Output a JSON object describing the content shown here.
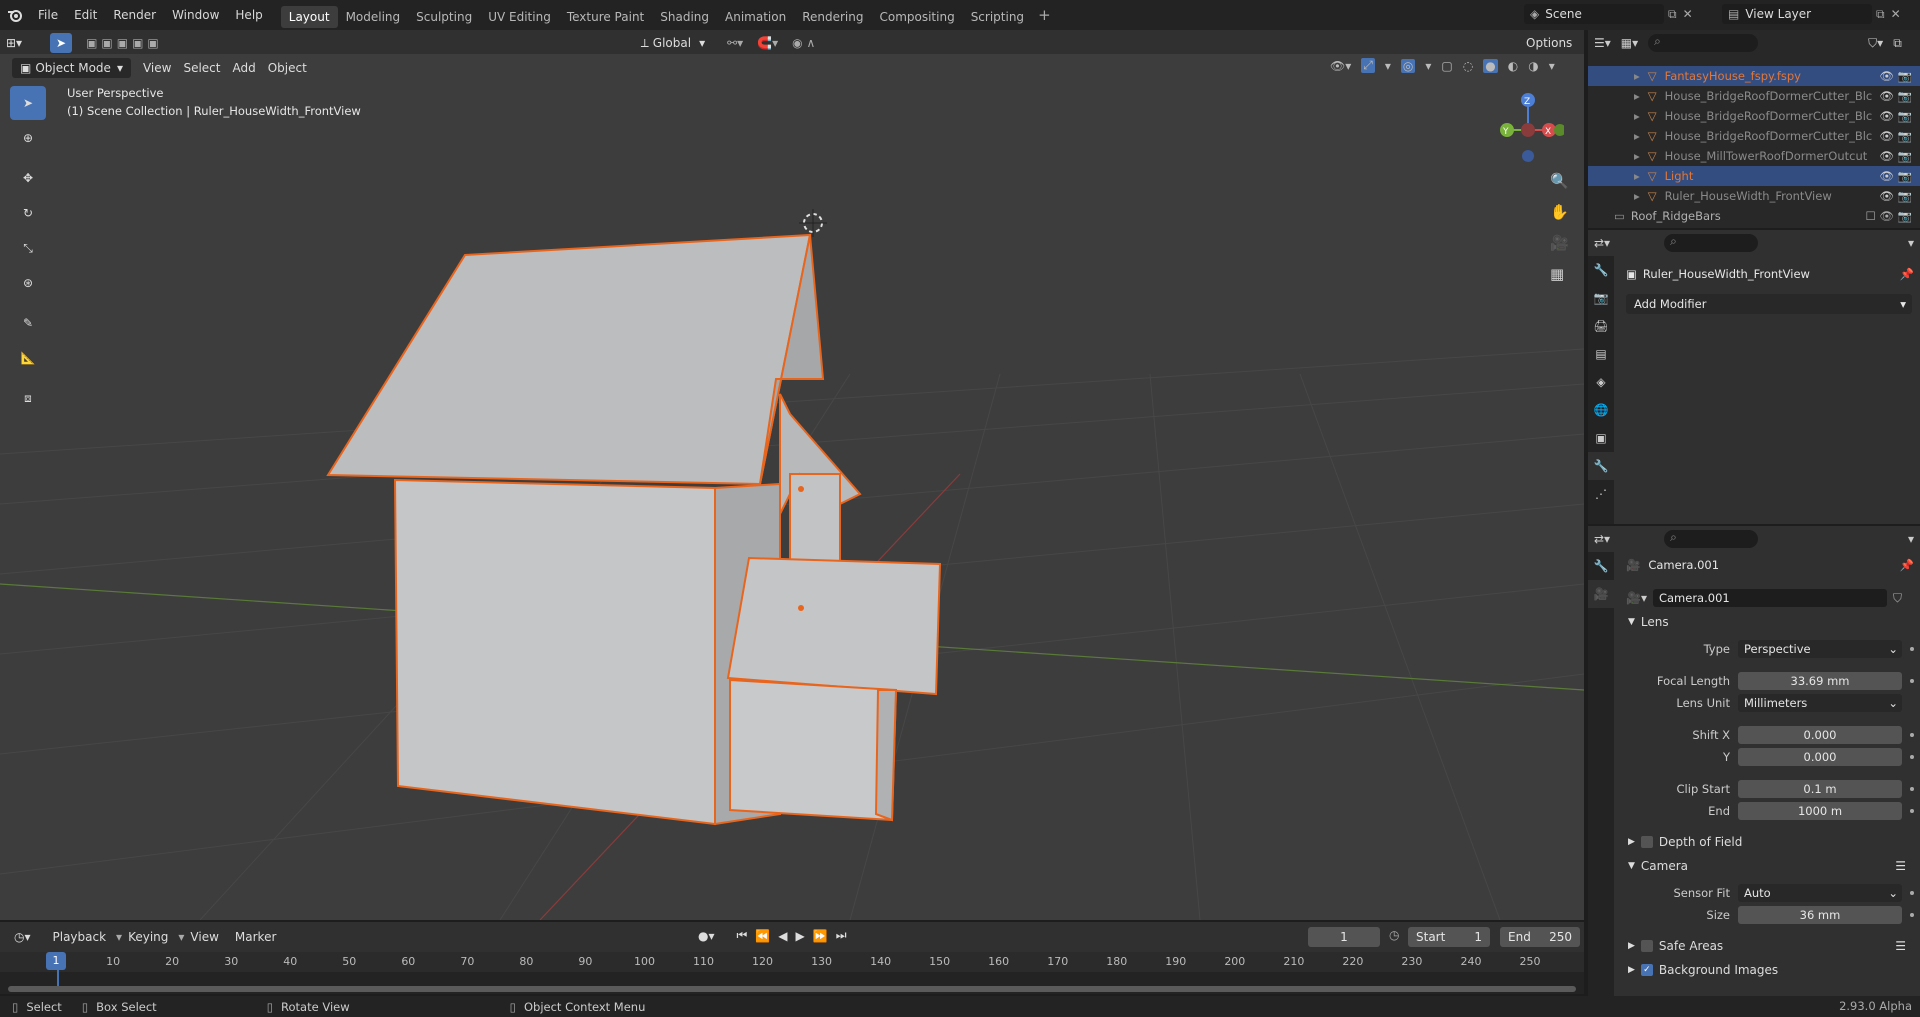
{
  "topbar": {
    "menus": [
      "File",
      "Edit",
      "Render",
      "Window",
      "Help"
    ],
    "workspaces": [
      "Layout",
      "Modeling",
      "Sculpting",
      "UV Editing",
      "Texture Paint",
      "Shading",
      "Animation",
      "Rendering",
      "Compositing",
      "Scripting"
    ],
    "active_workspace": "Layout",
    "scene": "Scene",
    "view_layer": "View Layer"
  },
  "viewport_header": {
    "mode": "Object Mode",
    "menus": [
      "View",
      "Select",
      "Add",
      "Object"
    ],
    "transform_orientation": "Global",
    "options_label": "Options"
  },
  "viewport": {
    "perspective_label": "User Perspective",
    "collection_label": "(1) Scene Collection | Ruler_HouseWidth_FrontView",
    "gizmo": {
      "x": "X",
      "y": "Y",
      "z": "Z"
    }
  },
  "outliner": {
    "items": [
      {
        "label": "FantasyHouse_fspy.fspy",
        "selected": true,
        "color": "#e0773a"
      },
      {
        "label": "House_BridgeRoofDormerCutter_Blc",
        "selected": false,
        "color": "#8a8a8a"
      },
      {
        "label": "House_BridgeRoofDormerCutter_Blc",
        "selected": false,
        "color": "#8a8a8a"
      },
      {
        "label": "House_BridgeRoofDormerCutter_Blc",
        "selected": false,
        "color": "#8a8a8a"
      },
      {
        "label": "House_MillTowerRoofDormerOutcut",
        "selected": false,
        "color": "#8a8a8a"
      },
      {
        "label": "Light",
        "selected": true,
        "color": "#e0773a"
      },
      {
        "label": "Ruler_HouseWidth_FrontView",
        "selected": false,
        "color": "#8a8a8a"
      }
    ],
    "collection": "Roof_RidgeBars"
  },
  "modifier_panel": {
    "object_name": "Ruler_HouseWidth_FrontView",
    "add_modifier": "Add Modifier"
  },
  "camera_panel": {
    "object_name": "Camera.001",
    "data_name": "Camera.001",
    "lens_section": "Lens",
    "type_label": "Type",
    "type_value": "Perspective",
    "focal_label": "Focal Length",
    "focal_value": "33.69 mm",
    "lens_unit_label": "Lens Unit",
    "lens_unit_value": "Millimeters",
    "shift_x_label": "Shift X",
    "shift_x_value": "0.000",
    "shift_y_label": "Y",
    "shift_y_value": "0.000",
    "clip_start_label": "Clip Start",
    "clip_start_value": "0.1 m",
    "clip_end_label": "End",
    "clip_end_value": "1000 m",
    "dof_section": "Depth of Field",
    "camera_section": "Camera",
    "sensor_fit_label": "Sensor Fit",
    "sensor_fit_value": "Auto",
    "size_label": "Size",
    "size_value": "36 mm",
    "safe_areas": "Safe Areas",
    "background_images": "Background Images"
  },
  "timeline": {
    "menus": [
      "Playback",
      "Keying",
      "View",
      "Marker"
    ],
    "current_frame": "1",
    "start_label": "Start",
    "start_value": "1",
    "end_label": "End",
    "end_value": "250",
    "ticks": [
      "1",
      "10",
      "20",
      "30",
      "40",
      "50",
      "60",
      "70",
      "80",
      "90",
      "100",
      "110",
      "120",
      "130",
      "140",
      "150",
      "160",
      "170",
      "180",
      "190",
      "200",
      "210",
      "220",
      "230",
      "240",
      "250"
    ]
  },
  "statusbar": {
    "select": "Select",
    "box_select": "Box Select",
    "rotate_view": "Rotate View",
    "context_menu": "Object Context Menu",
    "version": "2.93.0 Alpha"
  }
}
